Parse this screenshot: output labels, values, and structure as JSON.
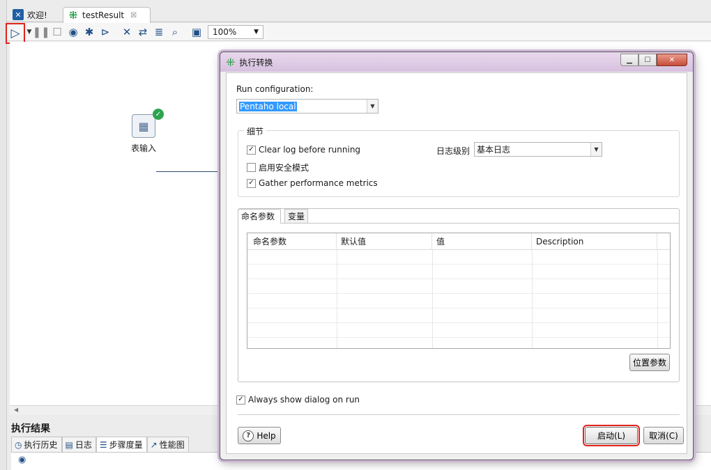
{
  "editor": {
    "tabs": [
      {
        "label": "欢迎!",
        "icon": "welcome-icon"
      },
      {
        "label": "testResult",
        "icon": "transformation-icon",
        "close": "☒"
      }
    ],
    "zoom": "100%",
    "step": {
      "label": "表输入",
      "status": "success"
    },
    "results": {
      "title": "执行结果",
      "tabs": [
        "执行历史",
        "日志",
        "步骤度量",
        "性能图"
      ]
    }
  },
  "dialog": {
    "title": "执行转换",
    "run_configuration_label": "Run configuration:",
    "run_configuration_value": "Pentaho local",
    "details_group": "细节",
    "clear_log_label": "Clear log before running",
    "clear_log_checked": true,
    "safe_mode_label": "启用安全模式",
    "safe_mode_checked": false,
    "perf_metrics_label": "Gather performance metrics",
    "perf_metrics_checked": true,
    "log_level_label": "日志级别",
    "log_level_value": "基本日志",
    "params_tab": "命名参数",
    "vars_tab": "变量",
    "table_headers": [
      "命名参数",
      "默认值",
      "值",
      "Description"
    ],
    "position_params_button": "位置参数",
    "always_show_label": "Always show dialog on run",
    "always_show_checked": true,
    "help_button": "Help",
    "launch_button": "启动(L)",
    "cancel_button": "取消(C)"
  },
  "colors": {
    "highlight_red": "#e2231a",
    "accent_blue": "#1f4f86",
    "success_green": "#2da44e"
  }
}
